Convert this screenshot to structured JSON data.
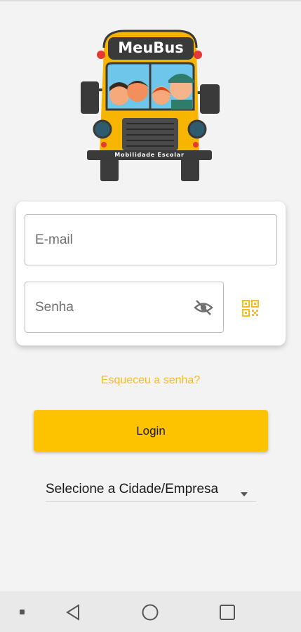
{
  "logo": {
    "brand": "MeuBus",
    "tagline": "Mobilidade Escolar"
  },
  "login_form": {
    "email_placeholder": "E-mail",
    "password_placeholder": "Senha",
    "visibility_icon": "eye-off-icon",
    "qr_icon": "qr-code-icon"
  },
  "forgot_password": "Esqueceu a senha?",
  "login_button": "Login",
  "city_select": {
    "selected": "Selecione a Cidade/Empresa"
  },
  "colors": {
    "accent": "#fec300",
    "link": "#f5bd1d",
    "background": "#f3f3f3"
  },
  "navbar": {
    "icons": [
      "menu-dot-icon",
      "back-icon",
      "home-icon",
      "recents-icon"
    ]
  }
}
